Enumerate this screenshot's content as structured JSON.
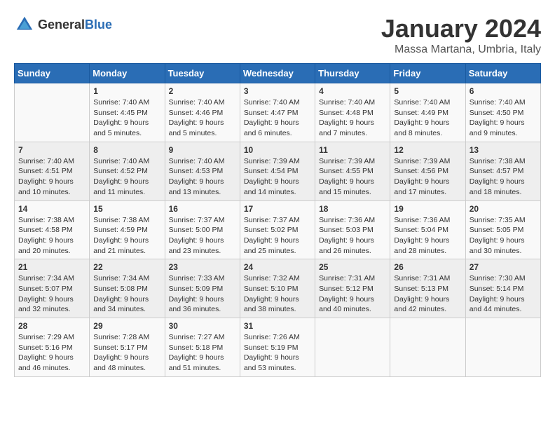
{
  "logo": {
    "text_general": "General",
    "text_blue": "Blue"
  },
  "header": {
    "month_year": "January 2024",
    "location": "Massa Martana, Umbria, Italy"
  },
  "days_of_week": [
    "Sunday",
    "Monday",
    "Tuesday",
    "Wednesday",
    "Thursday",
    "Friday",
    "Saturday"
  ],
  "weeks": [
    [
      {
        "day": "",
        "sunrise": "",
        "sunset": "",
        "daylight": ""
      },
      {
        "day": "1",
        "sunrise": "Sunrise: 7:40 AM",
        "sunset": "Sunset: 4:45 PM",
        "daylight": "Daylight: 9 hours and 5 minutes."
      },
      {
        "day": "2",
        "sunrise": "Sunrise: 7:40 AM",
        "sunset": "Sunset: 4:46 PM",
        "daylight": "Daylight: 9 hours and 5 minutes."
      },
      {
        "day": "3",
        "sunrise": "Sunrise: 7:40 AM",
        "sunset": "Sunset: 4:47 PM",
        "daylight": "Daylight: 9 hours and 6 minutes."
      },
      {
        "day": "4",
        "sunrise": "Sunrise: 7:40 AM",
        "sunset": "Sunset: 4:48 PM",
        "daylight": "Daylight: 9 hours and 7 minutes."
      },
      {
        "day": "5",
        "sunrise": "Sunrise: 7:40 AM",
        "sunset": "Sunset: 4:49 PM",
        "daylight": "Daylight: 9 hours and 8 minutes."
      },
      {
        "day": "6",
        "sunrise": "Sunrise: 7:40 AM",
        "sunset": "Sunset: 4:50 PM",
        "daylight": "Daylight: 9 hours and 9 minutes."
      }
    ],
    [
      {
        "day": "7",
        "sunrise": "Sunrise: 7:40 AM",
        "sunset": "Sunset: 4:51 PM",
        "daylight": "Daylight: 9 hours and 10 minutes."
      },
      {
        "day": "8",
        "sunrise": "Sunrise: 7:40 AM",
        "sunset": "Sunset: 4:52 PM",
        "daylight": "Daylight: 9 hours and 11 minutes."
      },
      {
        "day": "9",
        "sunrise": "Sunrise: 7:40 AM",
        "sunset": "Sunset: 4:53 PM",
        "daylight": "Daylight: 9 hours and 13 minutes."
      },
      {
        "day": "10",
        "sunrise": "Sunrise: 7:39 AM",
        "sunset": "Sunset: 4:54 PM",
        "daylight": "Daylight: 9 hours and 14 minutes."
      },
      {
        "day": "11",
        "sunrise": "Sunrise: 7:39 AM",
        "sunset": "Sunset: 4:55 PM",
        "daylight": "Daylight: 9 hours and 15 minutes."
      },
      {
        "day": "12",
        "sunrise": "Sunrise: 7:39 AM",
        "sunset": "Sunset: 4:56 PM",
        "daylight": "Daylight: 9 hours and 17 minutes."
      },
      {
        "day": "13",
        "sunrise": "Sunrise: 7:38 AM",
        "sunset": "Sunset: 4:57 PM",
        "daylight": "Daylight: 9 hours and 18 minutes."
      }
    ],
    [
      {
        "day": "14",
        "sunrise": "Sunrise: 7:38 AM",
        "sunset": "Sunset: 4:58 PM",
        "daylight": "Daylight: 9 hours and 20 minutes."
      },
      {
        "day": "15",
        "sunrise": "Sunrise: 7:38 AM",
        "sunset": "Sunset: 4:59 PM",
        "daylight": "Daylight: 9 hours and 21 minutes."
      },
      {
        "day": "16",
        "sunrise": "Sunrise: 7:37 AM",
        "sunset": "Sunset: 5:00 PM",
        "daylight": "Daylight: 9 hours and 23 minutes."
      },
      {
        "day": "17",
        "sunrise": "Sunrise: 7:37 AM",
        "sunset": "Sunset: 5:02 PM",
        "daylight": "Daylight: 9 hours and 25 minutes."
      },
      {
        "day": "18",
        "sunrise": "Sunrise: 7:36 AM",
        "sunset": "Sunset: 5:03 PM",
        "daylight": "Daylight: 9 hours and 26 minutes."
      },
      {
        "day": "19",
        "sunrise": "Sunrise: 7:36 AM",
        "sunset": "Sunset: 5:04 PM",
        "daylight": "Daylight: 9 hours and 28 minutes."
      },
      {
        "day": "20",
        "sunrise": "Sunrise: 7:35 AM",
        "sunset": "Sunset: 5:05 PM",
        "daylight": "Daylight: 9 hours and 30 minutes."
      }
    ],
    [
      {
        "day": "21",
        "sunrise": "Sunrise: 7:34 AM",
        "sunset": "Sunset: 5:07 PM",
        "daylight": "Daylight: 9 hours and 32 minutes."
      },
      {
        "day": "22",
        "sunrise": "Sunrise: 7:34 AM",
        "sunset": "Sunset: 5:08 PM",
        "daylight": "Daylight: 9 hours and 34 minutes."
      },
      {
        "day": "23",
        "sunrise": "Sunrise: 7:33 AM",
        "sunset": "Sunset: 5:09 PM",
        "daylight": "Daylight: 9 hours and 36 minutes."
      },
      {
        "day": "24",
        "sunrise": "Sunrise: 7:32 AM",
        "sunset": "Sunset: 5:10 PM",
        "daylight": "Daylight: 9 hours and 38 minutes."
      },
      {
        "day": "25",
        "sunrise": "Sunrise: 7:31 AM",
        "sunset": "Sunset: 5:12 PM",
        "daylight": "Daylight: 9 hours and 40 minutes."
      },
      {
        "day": "26",
        "sunrise": "Sunrise: 7:31 AM",
        "sunset": "Sunset: 5:13 PM",
        "daylight": "Daylight: 9 hours and 42 minutes."
      },
      {
        "day": "27",
        "sunrise": "Sunrise: 7:30 AM",
        "sunset": "Sunset: 5:14 PM",
        "daylight": "Daylight: 9 hours and 44 minutes."
      }
    ],
    [
      {
        "day": "28",
        "sunrise": "Sunrise: 7:29 AM",
        "sunset": "Sunset: 5:16 PM",
        "daylight": "Daylight: 9 hours and 46 minutes."
      },
      {
        "day": "29",
        "sunrise": "Sunrise: 7:28 AM",
        "sunset": "Sunset: 5:17 PM",
        "daylight": "Daylight: 9 hours and 48 minutes."
      },
      {
        "day": "30",
        "sunrise": "Sunrise: 7:27 AM",
        "sunset": "Sunset: 5:18 PM",
        "daylight": "Daylight: 9 hours and 51 minutes."
      },
      {
        "day": "31",
        "sunrise": "Sunrise: 7:26 AM",
        "sunset": "Sunset: 5:19 PM",
        "daylight": "Daylight: 9 hours and 53 minutes."
      },
      {
        "day": "",
        "sunrise": "",
        "sunset": "",
        "daylight": ""
      },
      {
        "day": "",
        "sunrise": "",
        "sunset": "",
        "daylight": ""
      },
      {
        "day": "",
        "sunrise": "",
        "sunset": "",
        "daylight": ""
      }
    ]
  ]
}
